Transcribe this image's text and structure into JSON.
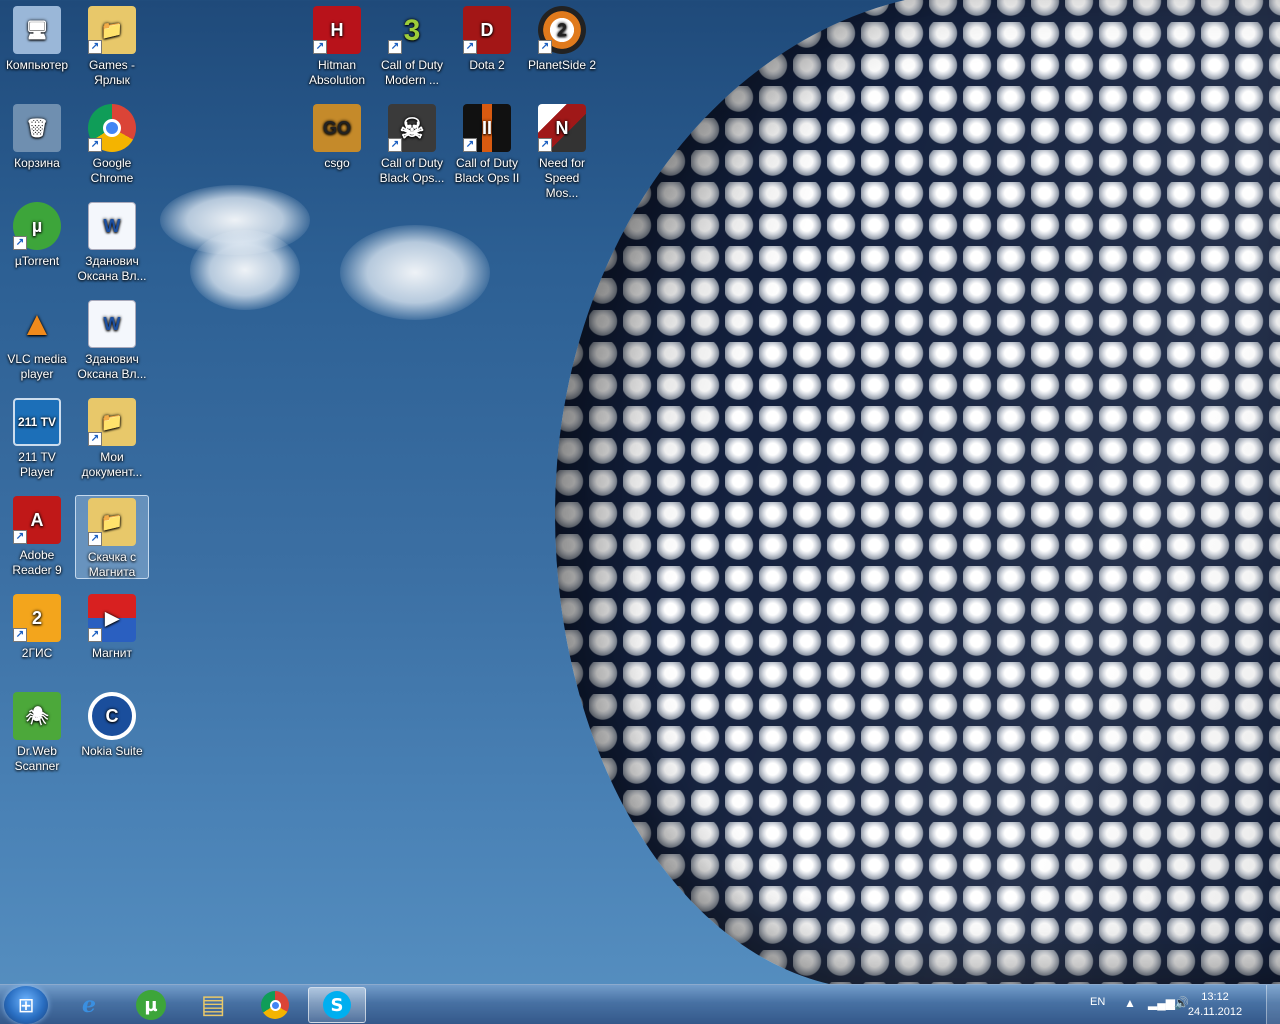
{
  "desktop_icons": [
    {
      "id": "computer",
      "label": "Компьютер",
      "glyph": "🖥",
      "bg": "#9ab7d8"
    },
    {
      "id": "games",
      "label": "Games - Ярлык",
      "glyph": "📁",
      "bg": "#e8c86a"
    },
    {
      "id": "hitman",
      "label": "Hitman Absolution",
      "glyph": "H",
      "bg": "#b8121a"
    },
    {
      "id": "cod-mw",
      "label": "Call of Duty Modern ...",
      "glyph": "3",
      "bg": "#2b3b1a"
    },
    {
      "id": "dota2",
      "label": "Dota 2",
      "glyph": "D",
      "bg": "#a31616"
    },
    {
      "id": "planetside2",
      "label": "PlanetSide 2",
      "glyph": "2",
      "bg": "#1a1a1a"
    },
    {
      "id": "recycle-bin",
      "label": "Корзина",
      "glyph": "🗑",
      "bg": "#6f8fb0"
    },
    {
      "id": "google-chrome",
      "label": "Google Chrome",
      "glyph": "◉",
      "bg": "#3a8f3a"
    },
    {
      "id": "csgo",
      "label": "csgo",
      "glyph": "GO",
      "bg": "#c58a2a"
    },
    {
      "id": "cod-bo",
      "label": "Call of Duty Black Ops...",
      "glyph": "☠",
      "bg": "#3a3a3a"
    },
    {
      "id": "cod-bo2",
      "label": "Call of Duty Black Ops II",
      "glyph": "II",
      "bg": "#d85a10"
    },
    {
      "id": "nfs",
      "label": "Need for Speed Mos...",
      "glyph": "N",
      "bg": "#a01818"
    },
    {
      "id": "utorrent",
      "label": "µTorrent",
      "glyph": "µ",
      "bg": "#3da53a"
    },
    {
      "id": "doc1",
      "label": "Зданович Оксана Вл...",
      "glyph": "W",
      "bg": "#dbe6f5"
    },
    {
      "id": "vlc",
      "label": "VLC media player",
      "glyph": "▲",
      "bg": "#f08a1c"
    },
    {
      "id": "doc2",
      "label": "Зданович Оксана Вл...",
      "glyph": "W",
      "bg": "#dbe6f5"
    },
    {
      "id": "211tv",
      "label": "211 TV Player",
      "glyph": "211 TV",
      "bg": "#1c6fb8"
    },
    {
      "id": "my-docs",
      "label": "Мои документ...",
      "glyph": "📁",
      "bg": "#e8c86a"
    },
    {
      "id": "adobe-reader",
      "label": "Adobe Reader 9",
      "glyph": "A",
      "bg": "#c01818"
    },
    {
      "id": "skachka",
      "label": "Скачка с Магнита",
      "glyph": "📁",
      "bg": "#e8c86a"
    },
    {
      "id": "2gis",
      "label": "2ГИС",
      "glyph": "2",
      "bg": "#f3a51c"
    },
    {
      "id": "magnit",
      "label": "Магнит",
      "glyph": "▶",
      "bg": "#d82020"
    },
    {
      "id": "drweb",
      "label": "Dr.Web Scanner",
      "glyph": "🕷",
      "bg": "#4ca83a"
    },
    {
      "id": "nokia-suite",
      "label": "Nokia Suite",
      "glyph": "C",
      "bg": "#1a4e9c"
    }
  ],
  "taskbar": {
    "pinned": [
      {
        "id": "ie",
        "glyph": "e",
        "color": "#3a8fe0"
      },
      {
        "id": "utorrent",
        "glyph": "µ",
        "color": "#3da53a"
      },
      {
        "id": "explorer",
        "glyph": "▤",
        "color": "#e8c86a"
      },
      {
        "id": "chrome",
        "glyph": "◉",
        "color": "#e04a2a"
      },
      {
        "id": "skype",
        "glyph": "S",
        "color": "#00aff0"
      }
    ],
    "tray": {
      "language": "EN",
      "time": "13:12",
      "date": "24.11.2012"
    }
  }
}
